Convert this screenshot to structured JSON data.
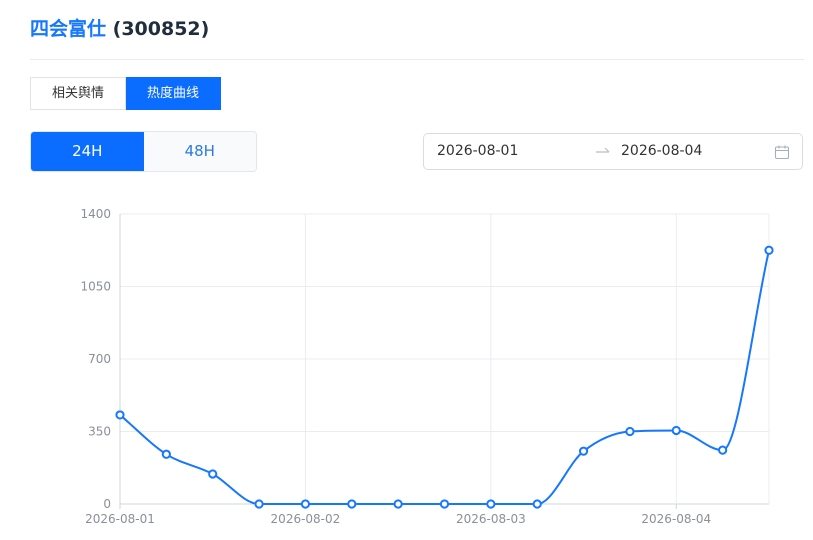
{
  "header": {
    "name": "四会富仕",
    "code": "(300852)"
  },
  "tabs": [
    {
      "label": "相关舆情",
      "active": false
    },
    {
      "label": "热度曲线",
      "active": true
    }
  ],
  "period": {
    "options": [
      {
        "label": "24H",
        "active": true
      },
      {
        "label": "48H",
        "active": false
      }
    ]
  },
  "date_range": {
    "start": "2026-08-01",
    "end": "2026-08-04"
  },
  "icons": {
    "range_separator": "arrow-right-icon",
    "calendar": "calendar-icon"
  },
  "colors": {
    "accent": "#0a6dff",
    "line": "#1677ff",
    "grid": "#e9edf2"
  },
  "chart_data": {
    "type": "line",
    "x": [
      "2026-08-01 00:00",
      "2026-08-01 12:00",
      "2026-08-02 00:00",
      "2026-08-02 12:00",
      "2026-08-03 00:00",
      "2026-08-03 12:00",
      "2026-08-04 00:00",
      "2026-08-04 12:00"
    ],
    "x_ticks": [
      "2026-08-01",
      "2026-08-02",
      "2026-08-03",
      "2026-08-04"
    ],
    "series": [
      {
        "points": [
          [
            "2026-08-01 00:00",
            430
          ],
          [
            "2026-08-01 06:00",
            240
          ],
          [
            "2026-08-01 12:00",
            145
          ],
          [
            "2026-08-01 18:00",
            0
          ],
          [
            "2026-08-02 00:00",
            0
          ],
          [
            "2026-08-02 06:00",
            0
          ],
          [
            "2026-08-02 12:00",
            0
          ],
          [
            "2026-08-02 18:00",
            0
          ],
          [
            "2026-08-03 00:00",
            0
          ],
          [
            "2026-08-03 06:00",
            0
          ],
          [
            "2026-08-03 12:00",
            255
          ],
          [
            "2026-08-03 18:00",
            350
          ],
          [
            "2026-08-04 00:00",
            355
          ],
          [
            "2026-08-04 06:00",
            260
          ],
          [
            "2026-08-04 12:00",
            1225
          ]
        ]
      }
    ],
    "y_ticks": [
      0,
      350,
      700,
      1050,
      1400
    ],
    "ylim": [
      0,
      1400
    ],
    "xlim": [
      "2026-08-01 00:00",
      "2026-08-04 12:00"
    ],
    "grid": true,
    "smooth": true,
    "markers": "hollow-circle",
    "title": "",
    "xlabel": "",
    "ylabel": ""
  }
}
